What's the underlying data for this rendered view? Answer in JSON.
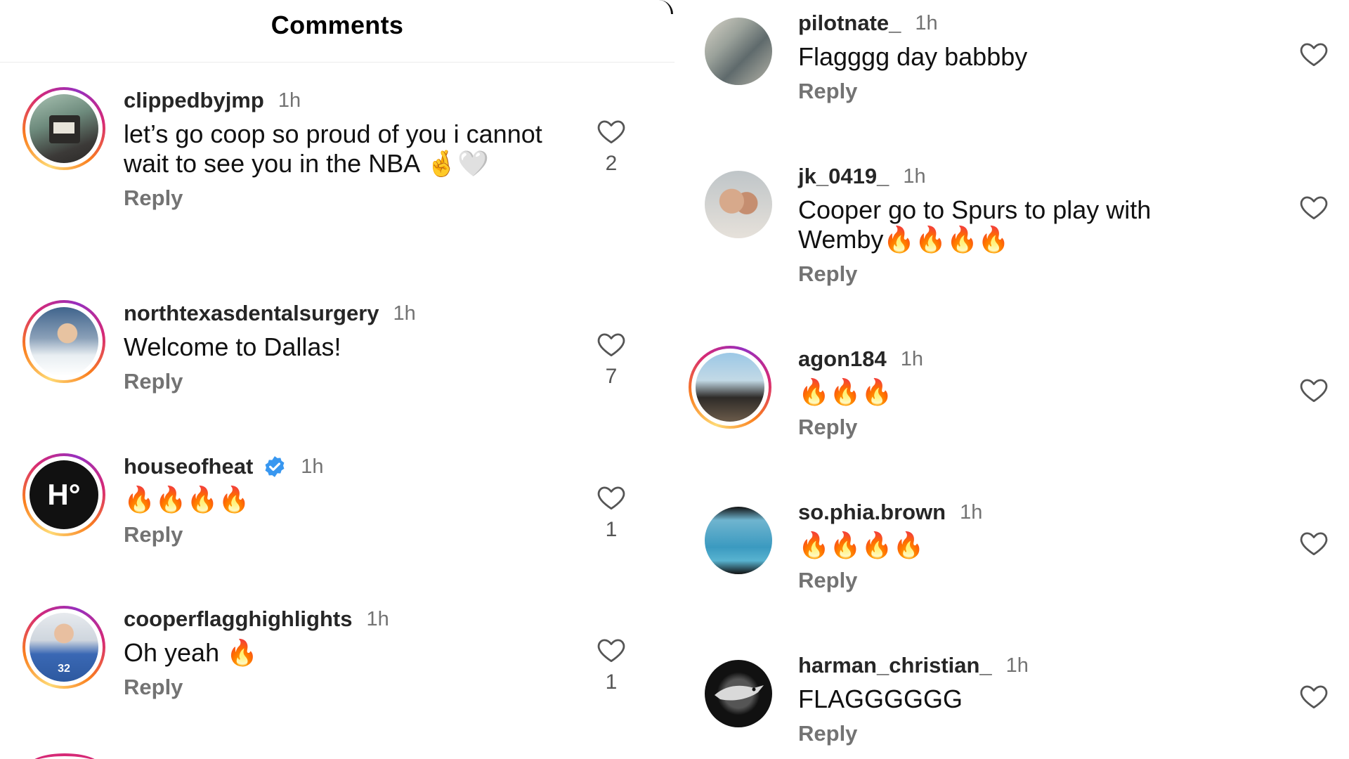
{
  "header": {
    "title": "Comments"
  },
  "reply_label": "Reply",
  "left_comments": [
    {
      "username": "clippedbyjmp",
      "time": "1h",
      "text": "let’s go coop so proud of you i cannot wait to see you in the NBA 🤞🤍",
      "likes": "2",
      "avatar_icon": "profile-photo"
    },
    {
      "username": "northtexasdentalsurgery",
      "time": "1h",
      "text": "Welcome to Dallas!",
      "likes": "7",
      "avatar_icon": "profile-photo"
    },
    {
      "username": "houseofheat",
      "time": "1h",
      "text": "🔥🔥🔥🔥",
      "likes": "1",
      "verified": true,
      "avatar_text": "H°"
    },
    {
      "username": "cooperflagghighlights",
      "time": "1h",
      "text": "Oh yeah 🔥",
      "likes": "1",
      "avatar_icon": "profile-photo"
    }
  ],
  "right_comments": [
    {
      "username": "pilotnate_",
      "time": "1h",
      "text": "Flagggg day babbby",
      "avatar_icon": "profile-photo"
    },
    {
      "username": "jk_0419_",
      "time": "1h",
      "text": "Cooper go to Spurs to play with Wemby🔥🔥🔥🔥",
      "avatar_icon": "profile-photo"
    },
    {
      "username": "agon184",
      "time": "1h",
      "text": "🔥🔥🔥",
      "avatar_icon": "profile-photo"
    },
    {
      "username": "so.phia.brown",
      "time": "1h",
      "text": "🔥🔥🔥🔥",
      "avatar_icon": "profile-photo"
    },
    {
      "username": "harman_christian_",
      "time": "1h",
      "text": "FLAGGGGGG",
      "avatar_icon": "profile-photo"
    }
  ],
  "colors": {
    "verified": "#3897f0",
    "muted_text": "#737373",
    "story_ring": [
      "#feda75",
      "#fa7e1e",
      "#d62976",
      "#962fbf"
    ]
  }
}
